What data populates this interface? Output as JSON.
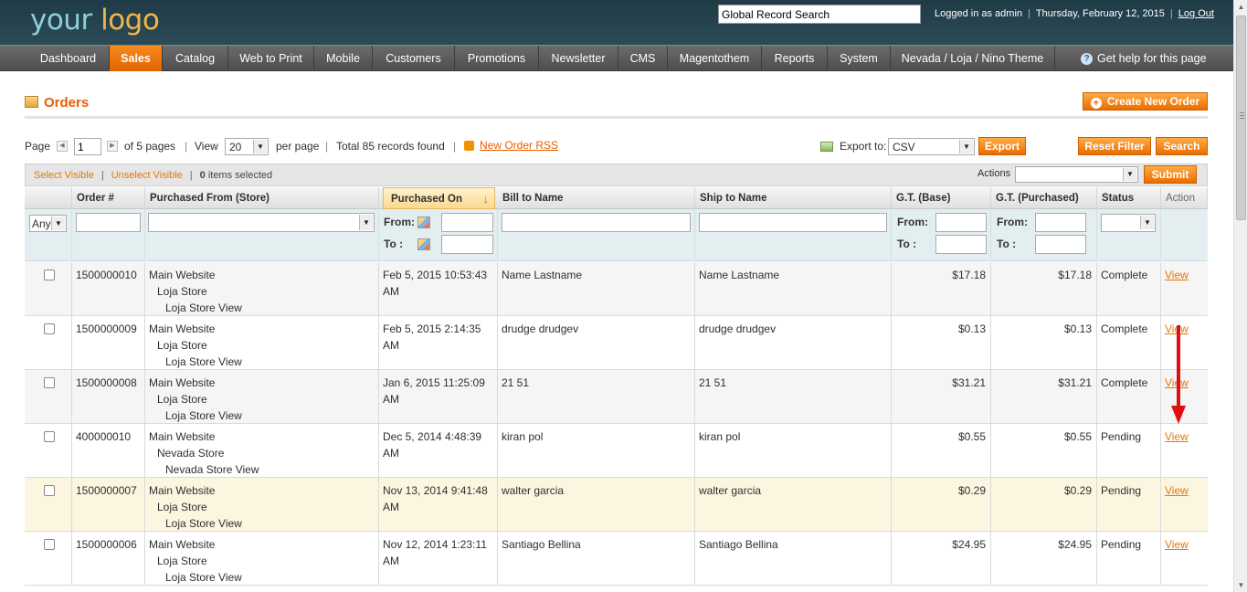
{
  "header": {
    "logo_main": "your",
    "logo_accent": "logo",
    "global_search": "Global Record Search",
    "logged_in": "Logged in as admin",
    "date": "Thursday, February 12, 2015",
    "logout": "Log Out"
  },
  "nav": {
    "items": [
      "Dashboard",
      "Sales",
      "Catalog",
      "Web to Print",
      "Mobile",
      "Customers",
      "Promotions",
      "Newsletter",
      "CMS",
      "Magentothem",
      "Reports",
      "System",
      "Nevada / Loja / Nino Theme"
    ],
    "active": "Sales",
    "help": "Get help for this page"
  },
  "page": {
    "title": "Orders",
    "create_button": "Create New Order"
  },
  "pager": {
    "page_label": "Page",
    "page_value": "1",
    "of_pages": "of 5 pages",
    "view_label": "View",
    "view_value": "20",
    "per_page": "per page",
    "total": "Total 85 records found",
    "rss": "New Order RSS",
    "export_label": "Export to:",
    "export_value": "CSV",
    "export_button": "Export",
    "reset_button": "Reset Filter",
    "search_button": "Search"
  },
  "massaction": {
    "select_visible": "Select Visible",
    "unselect_visible": "Unselect Visible",
    "selected_count": "0",
    "selected_suffix": "items selected",
    "actions_label": "Actions",
    "submit": "Submit"
  },
  "columns": [
    "",
    "Order #",
    "Purchased From (Store)",
    "Purchased On",
    "Bill to Name",
    "Ship to Name",
    "G.T. (Base)",
    "G.T. (Purchased)",
    "Status",
    "Action"
  ],
  "filters": {
    "any": "Any",
    "from": "From:",
    "to": "To :"
  },
  "rows": [
    {
      "order": "1500000010",
      "site": "Main Website",
      "store": "Loja Store",
      "view": "Loja Store View",
      "date1": "Feb 5, 2015 10:53:43",
      "date2": "AM",
      "bill": "Name Lastname",
      "ship": "Name Lastname",
      "base": "$17.18",
      "purchased": "$17.18",
      "status": "Complete",
      "action": "View"
    },
    {
      "order": "1500000009",
      "site": "Main Website",
      "store": "Loja Store",
      "view": "Loja Store View",
      "date1": "Feb 5, 2015 2:14:35",
      "date2": "AM",
      "bill": "drudge drudgev",
      "ship": "drudge drudgev",
      "base": "$0.13",
      "purchased": "$0.13",
      "status": "Complete",
      "action": "View"
    },
    {
      "order": "1500000008",
      "site": "Main Website",
      "store": "Loja Store",
      "view": "Loja Store View",
      "date1": "Jan 6, 2015 11:25:09",
      "date2": "AM",
      "bill": "21 51",
      "ship": "21 51",
      "base": "$31.21",
      "purchased": "$31.21",
      "status": "Complete",
      "action": "View"
    },
    {
      "order": "400000010",
      "site": "Main Website",
      "store": "Nevada Store",
      "view": "Nevada Store View",
      "date1": "Dec 5, 2014 4:48:39",
      "date2": "AM",
      "bill": "kiran pol",
      "ship": "kiran pol",
      "base": "$0.55",
      "purchased": "$0.55",
      "status": "Pending",
      "action": "View"
    },
    {
      "order": "1500000007",
      "site": "Main Website",
      "store": "Loja Store",
      "view": "Loja Store View",
      "date1": "Nov 13, 2014 9:41:48",
      "date2": "AM",
      "bill": "walter garcia",
      "ship": "walter garcia",
      "base": "$0.29",
      "purchased": "$0.29",
      "status": "Pending",
      "action": "View"
    },
    {
      "order": "1500000006",
      "site": "Main Website",
      "store": "Loja Store",
      "view": "Loja Store View",
      "date1": "Nov 12, 2014 1:23:11",
      "date2": "AM",
      "bill": "Santiago Bellina",
      "ship": "Santiago Bellina",
      "base": "$24.95",
      "purchased": "$24.95",
      "status": "Pending",
      "action": "View"
    }
  ],
  "colors": {
    "accent": "#ea6d00",
    "header_bg": "#1f3b46",
    "nav_bg": "#555555",
    "annotation_arrow": "#e01010"
  }
}
